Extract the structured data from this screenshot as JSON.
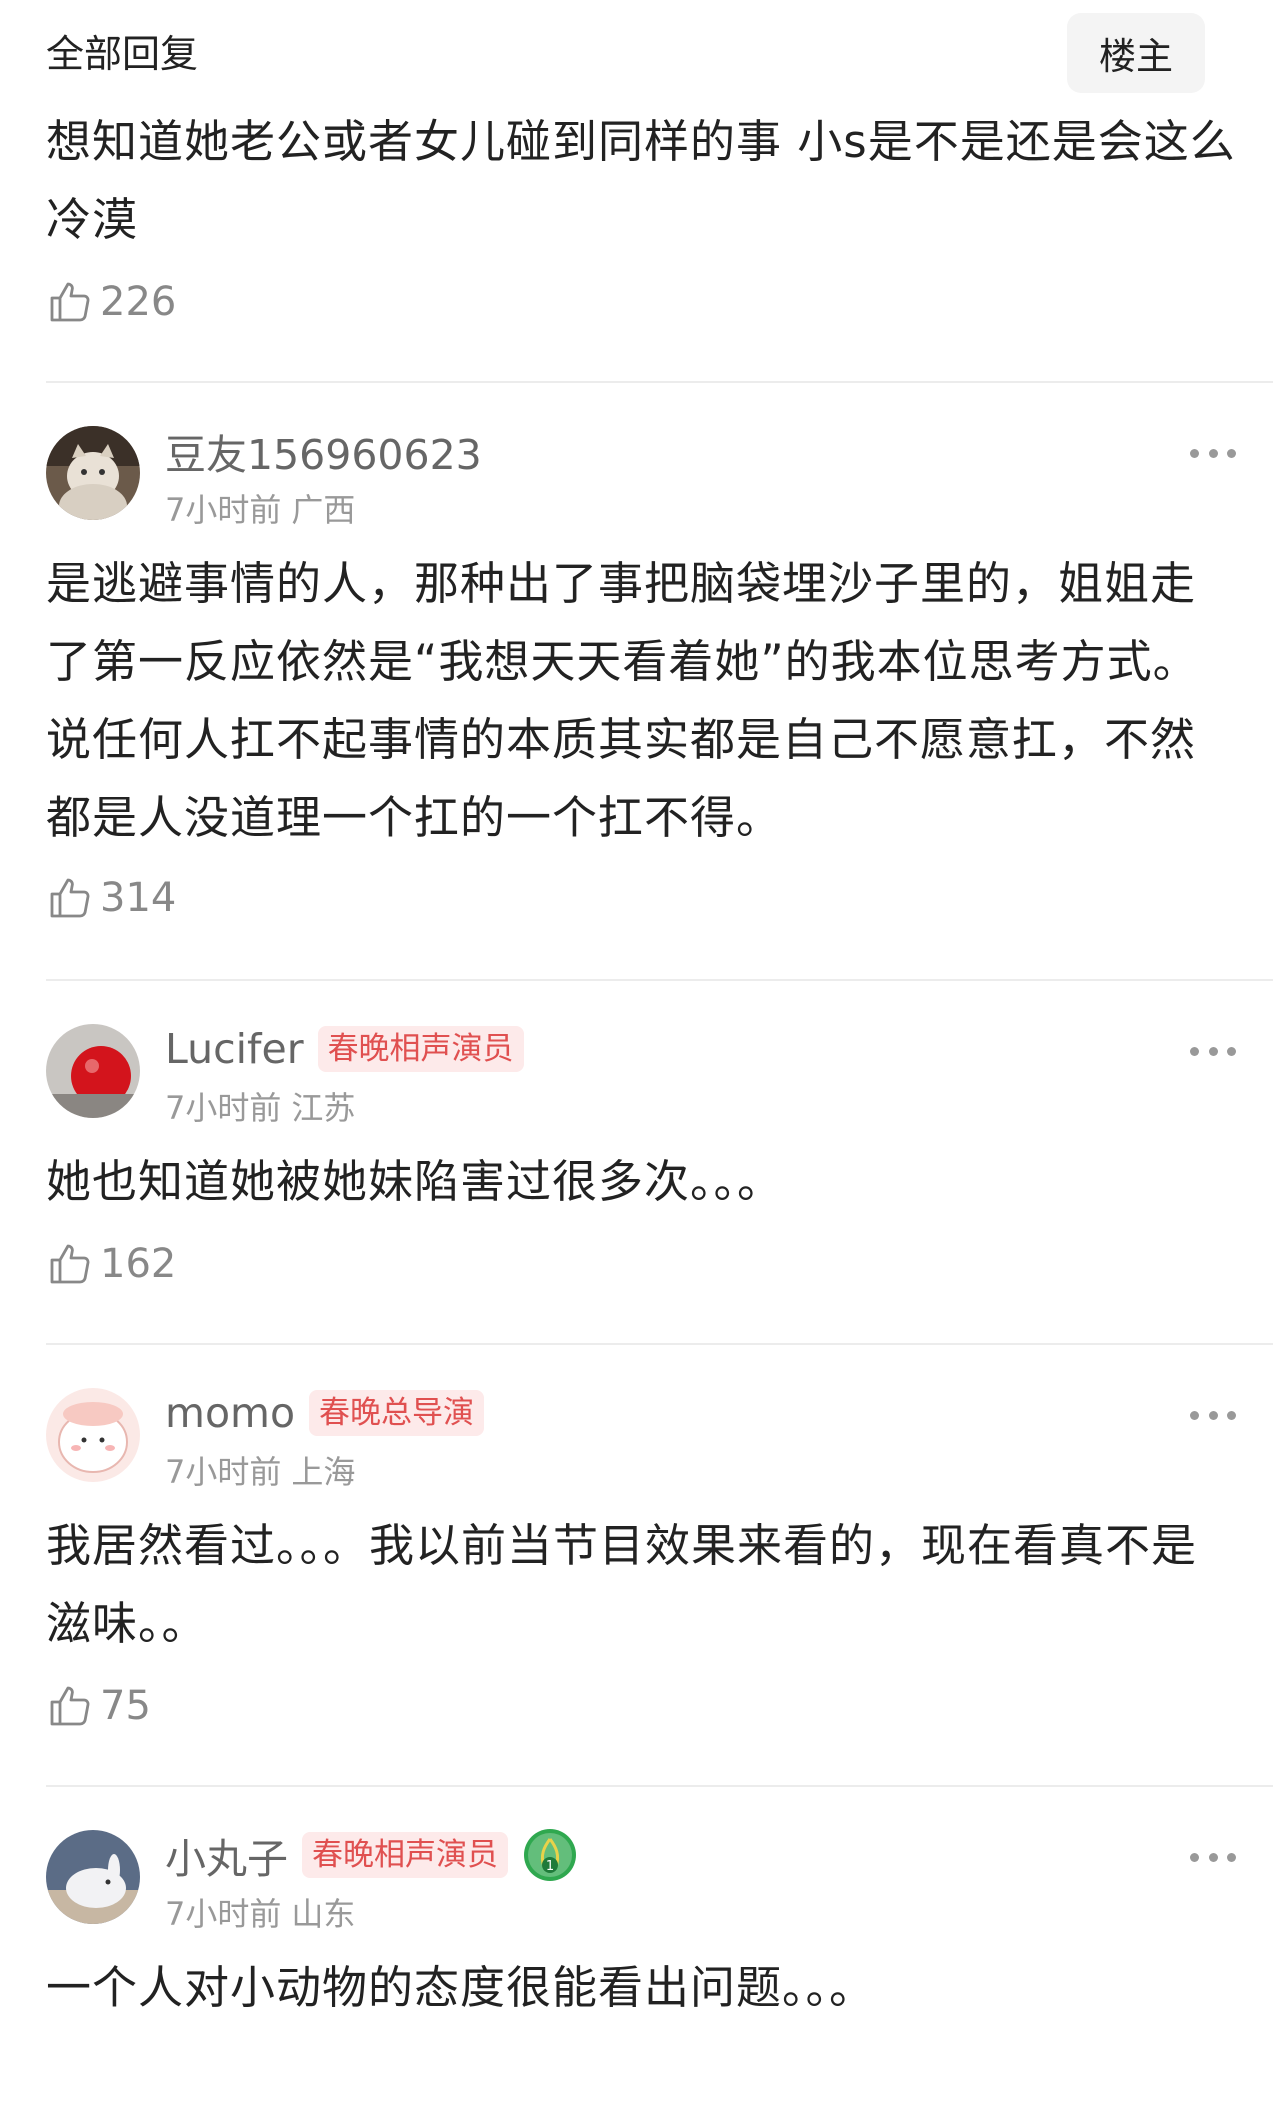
{
  "header": {
    "title": "全部回复",
    "op_label": "楼主"
  },
  "top_reply": {
    "text": "想知道她老公或者女儿碰到同样的事 小s是不是还是会这么冷漠",
    "likes": "226"
  },
  "comments": [
    {
      "username": "豆友156960623",
      "badge": "",
      "time": "7小时前",
      "location": "广西",
      "text": "是逃避事情的人，那种出了事把脑袋埋沙子里的，姐姐走了第一反应依然是“我想天天看着她”的我本位思考方式。\n说任何人扛不起事情的本质其实都是自己不愿意扛，不然都是人没道理一个扛的一个扛不得。",
      "likes": "314"
    },
    {
      "username": "Lucifer",
      "badge": "春晚相声演员",
      "time": "7小时前",
      "location": "江苏",
      "text": "她也知道她被她妹陷害过很多次。。。",
      "likes": "162"
    },
    {
      "username": "momo",
      "badge": "春晚总导演",
      "time": "7小时前",
      "location": "上海",
      "text": "我居然看过。。。我以前当节目效果来看的，现在看真不是滋味。。",
      "likes": "75"
    },
    {
      "username": "小丸子",
      "badge": "春晚相声演员",
      "level": "1",
      "time": "7小时前",
      "location": "山东",
      "text": "一个人对小动物的态度很能看出问题。。。",
      "likes": ""
    }
  ],
  "colors": {
    "badge_bg": "#fdeaea",
    "badge_text": "#e05050",
    "meta_gray": "#999999",
    "level_green": "#2fa84f"
  }
}
